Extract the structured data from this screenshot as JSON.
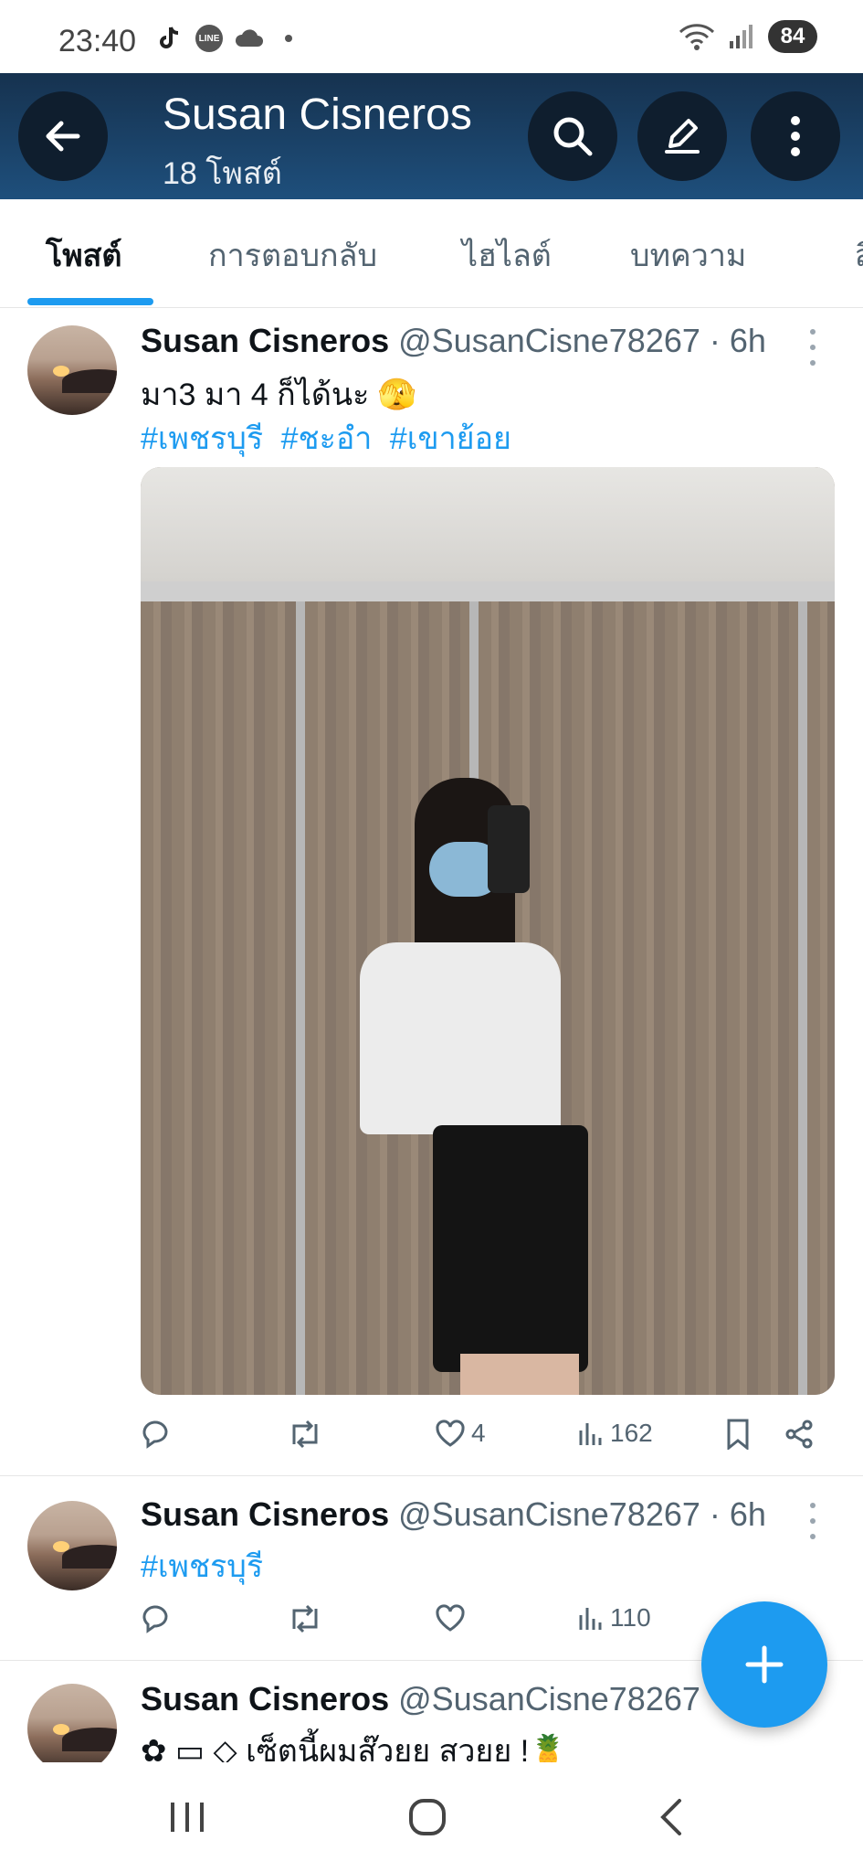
{
  "status_bar": {
    "time": "23:40",
    "battery": "84",
    "icons": [
      "tiktok-icon",
      "line-icon",
      "cloud-icon",
      "dot-icon",
      "wifi-icon",
      "signal-icon"
    ]
  },
  "header": {
    "title": "Susan Cisneros",
    "subtitle": "18 โพสต์"
  },
  "tabs": [
    {
      "label": "โพสต์",
      "active": true
    },
    {
      "label": "การตอบกลับ",
      "active": false
    },
    {
      "label": "ไฮไลต์",
      "active": false
    },
    {
      "label": "บทความ",
      "active": false
    },
    {
      "label": "สื่อ",
      "active": false
    }
  ],
  "posts": [
    {
      "name": "Susan Cisneros",
      "meta": "@SusanCisne78267 · 6h",
      "text": "มา3 มา 4 ก็ได้นะ 🫣",
      "hashtags": [
        "#เพชรบุรี",
        "#ชะอำ",
        "#เขาย้อย"
      ],
      "likes": "4",
      "views": "162"
    },
    {
      "name": "Susan Cisneros",
      "meta": "@SusanCisne78267 · 6h",
      "hashtags": [
        "#เพชรบุรี"
      ],
      "views": "110"
    },
    {
      "name": "Susan Cisneros",
      "meta": "@SusanCisne78267",
      "text": "✿ ▭ ◇ เซ็ตนี้ผมส๊วยย สวยย !🍍"
    }
  ],
  "colors": {
    "header_bg": "#1e4f7c",
    "accent": "#1d9bf0",
    "hashtag": "#1d9bf0"
  }
}
